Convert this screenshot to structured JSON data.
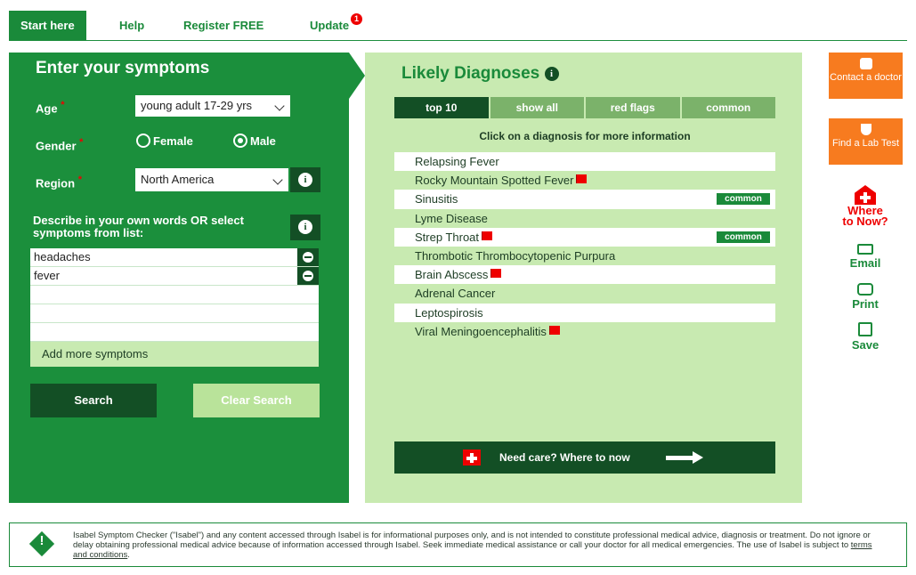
{
  "nav": {
    "tabs": [
      {
        "label": "Start here"
      },
      {
        "label": "Help"
      },
      {
        "label": "Register FREE"
      },
      {
        "label": "Update"
      }
    ],
    "update_badge": "1"
  },
  "form": {
    "title": "Enter your symptoms",
    "age_label": "Age",
    "age_value": "young adult 17-29 yrs",
    "gender_label": "Gender",
    "gender_options": [
      "Female",
      "Male"
    ],
    "gender_selected": "Male",
    "region_label": "Region",
    "region_value": "North America",
    "describe_label": "Describe in your own words OR select symptoms from list:",
    "symptoms": [
      "headaches",
      "fever",
      "",
      "",
      ""
    ],
    "add_more": "Add more symptoms",
    "search_btn": "Search",
    "clear_btn": "Clear Search",
    "required_marker": "*",
    "info_glyph": "i"
  },
  "diagnoses": {
    "title": "Likely Diagnoses",
    "tabs": [
      "top 10",
      "show all",
      "red flags",
      "common"
    ],
    "active_tab": "top 10",
    "hint": "Click on a diagnosis for more information",
    "items": [
      {
        "name": "Relapsing Fever",
        "red_flag": false,
        "tag": ""
      },
      {
        "name": "Rocky Mountain Spotted Fever",
        "red_flag": true,
        "tag": ""
      },
      {
        "name": "Sinusitis",
        "red_flag": false,
        "tag": "common"
      },
      {
        "name": "Lyme Disease",
        "red_flag": false,
        "tag": ""
      },
      {
        "name": "Strep Throat",
        "red_flag": true,
        "tag": "common"
      },
      {
        "name": "Thrombotic Thrombocytopenic Purpura",
        "red_flag": false,
        "tag": ""
      },
      {
        "name": "Brain Abscess",
        "red_flag": true,
        "tag": ""
      },
      {
        "name": "Adrenal Cancer",
        "red_flag": false,
        "tag": ""
      },
      {
        "name": "Leptospirosis",
        "red_flag": false,
        "tag": ""
      },
      {
        "name": "Viral Meningoencephalitis",
        "red_flag": true,
        "tag": ""
      }
    ],
    "need_care": "Need care? Where to now"
  },
  "side": {
    "contact_doctor": "Contact a doctor",
    "find_lab": "Find a Lab Test",
    "where_to_now": "Where to Now?",
    "email": "Email",
    "print": "Print",
    "save": "Save"
  },
  "disclaimer": {
    "text": "Isabel Symptom Checker (\"Isabel\") and any content accessed through Isabel is for informational purposes only, and is not intended to constitute professional medical advice, diagnosis or treatment. Do not ignore or delay obtaining professional medical advice because of information accessed through Isabel. Seek immediate medical assistance or call your doctor for all medical emergencies. The use of Isabel is subject to ",
    "link": "terms and conditions",
    "end": "."
  },
  "colors": {
    "dark_green": "#134f25",
    "green": "#1b8f3c",
    "light_green": "#c8eab1",
    "orange": "#f77b1f",
    "red": "#e00000"
  }
}
